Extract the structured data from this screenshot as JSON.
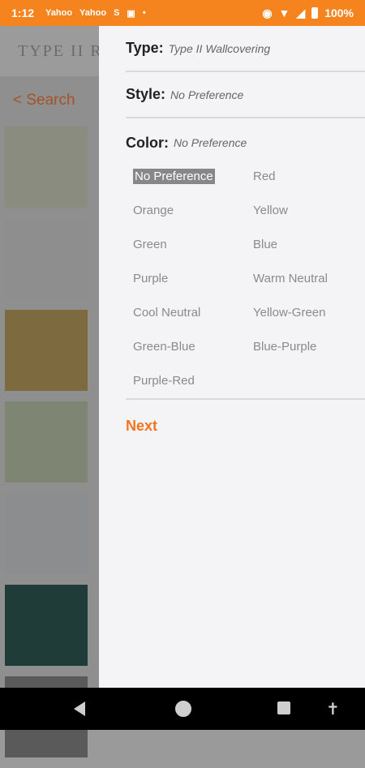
{
  "status_bar": {
    "time": "1:12",
    "icons": [
      "sim-icon",
      "sim-icon",
      "sync-icon",
      "device-icon",
      "dot-icon"
    ],
    "icon_text": [
      "Yahoo",
      "Yahoo",
      "S",
      "▣",
      "•"
    ],
    "battery": "100%"
  },
  "background": {
    "header_title": "TYPE II RE",
    "back_link": "< Search",
    "tile_colors": [
      "#8a8c7f",
      "#8e8e8e",
      "#7d6a3e",
      "#7f8573",
      "#8c8d8e",
      "#1f3c38",
      "#5a5a5a"
    ]
  },
  "drawer": {
    "type": {
      "label": "Type:",
      "value": "Type II Wallcovering"
    },
    "style": {
      "label": "Style:",
      "value": "No Preference"
    },
    "color": {
      "label": "Color:",
      "value": "No Preference",
      "selected": "No Preference",
      "options": [
        "No Preference",
        "Red",
        "Orange",
        "Yellow",
        "Green",
        "Blue",
        "Purple",
        "Warm Neutral",
        "Cool Neutral",
        "Yellow-Green",
        "Green-Blue",
        "Blue-Purple",
        "Purple-Red"
      ]
    },
    "next_label": "Next"
  },
  "colors": {
    "accent": "#f5731f",
    "status_bar": "#f5841f",
    "selected_bg": "#878787"
  }
}
